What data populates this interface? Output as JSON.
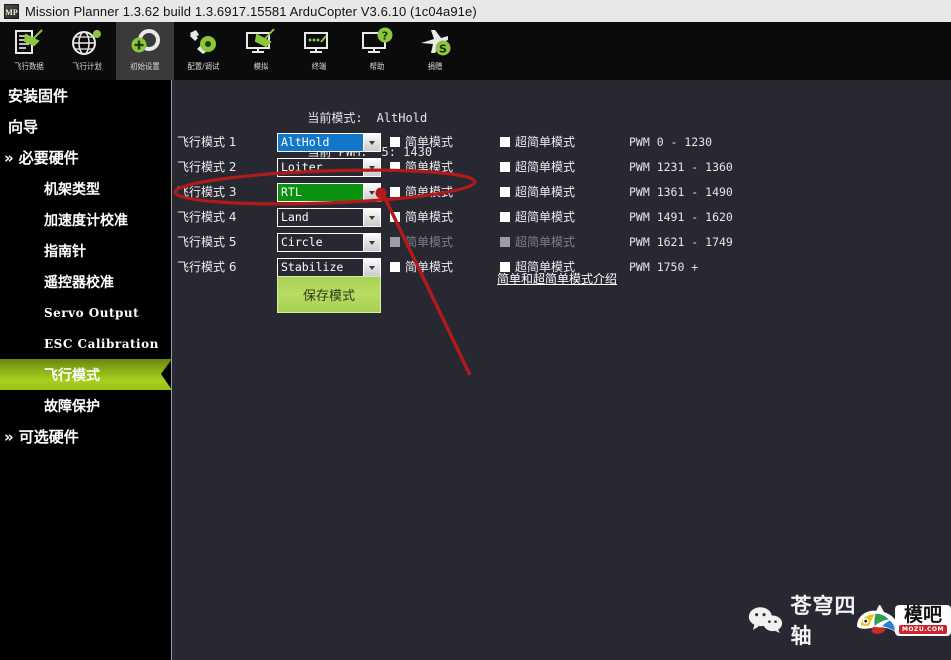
{
  "window": {
    "title": "Mission Planner 1.3.62 build 1.3.6917.15581 ArduCopter V3.6.10 (1c04a91e)",
    "app_icon": "MP"
  },
  "toolbar": {
    "items": [
      {
        "label": "飞行数据",
        "icon": "flight-data-icon",
        "active": false
      },
      {
        "label": "飞行计划",
        "icon": "flight-plan-icon",
        "active": false
      },
      {
        "label": "初始设置",
        "icon": "initial-setup-icon",
        "active": true
      },
      {
        "label": "配置/调试",
        "icon": "config-tuning-icon",
        "active": false
      },
      {
        "label": "模拟",
        "icon": "simulation-icon",
        "active": false
      },
      {
        "label": "终端",
        "icon": "terminal-icon",
        "active": false
      },
      {
        "label": "帮助",
        "icon": "help-icon",
        "active": false
      },
      {
        "label": "捐赠",
        "icon": "donate-icon",
        "active": false
      }
    ]
  },
  "sidebar": {
    "items": [
      {
        "label": "安装固件",
        "level": 0,
        "expander": "",
        "selected": false,
        "mono": false
      },
      {
        "label": "向导",
        "level": 0,
        "expander": "",
        "selected": false,
        "mono": false
      },
      {
        "label": "必要硬件",
        "level": 0,
        "expander": "»",
        "selected": false,
        "mono": false
      },
      {
        "label": "机架类型",
        "level": 1,
        "expander": "",
        "selected": false,
        "mono": false
      },
      {
        "label": "加速度计校准",
        "level": 1,
        "expander": "",
        "selected": false,
        "mono": false
      },
      {
        "label": "指南针",
        "level": 1,
        "expander": "",
        "selected": false,
        "mono": false
      },
      {
        "label": "遥控器校准",
        "level": 1,
        "expander": "",
        "selected": false,
        "mono": false
      },
      {
        "label": "Servo Output",
        "level": 1,
        "expander": "",
        "selected": false,
        "mono": true
      },
      {
        "label": "ESC Calibration",
        "level": 1,
        "expander": "",
        "selected": false,
        "mono": true
      },
      {
        "label": "飞行模式",
        "level": 1,
        "expander": "",
        "selected": true,
        "mono": false
      },
      {
        "label": "故障保护",
        "level": 1,
        "expander": "",
        "selected": false,
        "mono": false
      },
      {
        "label": "可选硬件",
        "level": 0,
        "expander": "»",
        "selected": false,
        "mono": false
      }
    ]
  },
  "main": {
    "status": {
      "current_mode_label": "当前模式:",
      "current_mode_value": "AltHold",
      "current_pwm_label": "当前 PWM:",
      "current_pwm_value": "5: 1430"
    },
    "simple_label": "简单模式",
    "super_simple_label": "超简单模式",
    "save_button": "保存模式",
    "help_link": "简单和超简单模式介绍",
    "rows": [
      {
        "label": "飞行模式 1",
        "mode": "AltHold",
        "highlight": "blue",
        "pwm": "PWM 0 - 1230",
        "disabled": false
      },
      {
        "label": "飞行模式 2",
        "mode": "Loiter",
        "highlight": "none",
        "pwm": "PWM 1231 - 1360",
        "disabled": false
      },
      {
        "label": "飞行模式 3",
        "mode": "RTL",
        "highlight": "green",
        "pwm": "PWM 1361 - 1490",
        "disabled": false
      },
      {
        "label": "飞行模式 4",
        "mode": "Land",
        "highlight": "none",
        "pwm": "PWM 1491 - 1620",
        "disabled": false
      },
      {
        "label": "飞行模式 5",
        "mode": "Circle",
        "highlight": "none",
        "pwm": "PWM 1621 - 1749",
        "disabled": true
      },
      {
        "label": "飞行模式 6",
        "mode": "Stabilize",
        "highlight": "none",
        "pwm": "PWM 1750 +",
        "disabled": false
      }
    ]
  },
  "annotation": {
    "color": "#b21a1a",
    "shapes": "ellipse-around-flight-mode-3 and arrow-to-rtl-dropdown"
  },
  "watermark": {
    "wechat_text": "苍穹四轴",
    "brand_text": "模吧",
    "brand_sub": "MOZU.COM"
  },
  "colors": {
    "sidebar_bg": "#000000",
    "main_bg": "#282833",
    "accent_green": "#a8d01e",
    "selected_blue": "#1277c9",
    "selected_green": "#0a9110",
    "annotation_red": "#b21a1a"
  }
}
